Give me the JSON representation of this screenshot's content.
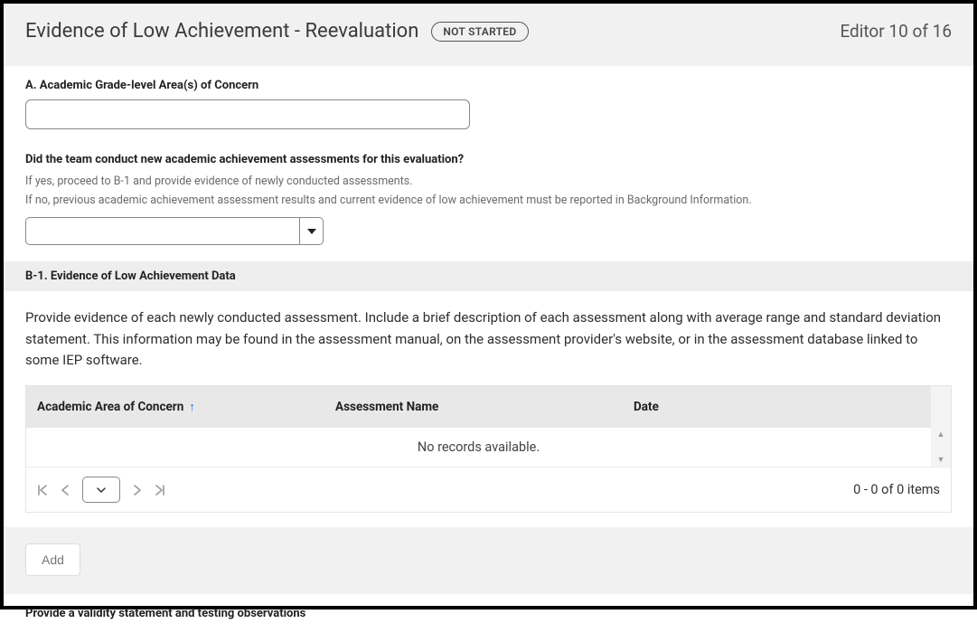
{
  "header": {
    "title": "Evidence of Low Achievement - Reevaluation",
    "status": "NOT STARTED",
    "counter": "Editor 10 of 16"
  },
  "sectionA": {
    "label": "A. Academic Grade-level Area(s) of Concern",
    "value": ""
  },
  "question": {
    "label": "Did the team conduct new academic achievement assessments for this evaluation?",
    "help1": "If yes, proceed to B-1 and provide evidence of newly conducted assessments.",
    "help2": "If no, previous academic achievement assessment results and current evidence of low achievement must be reported in Background Information.",
    "selected": ""
  },
  "sectionB": {
    "heading": "B-1. Evidence of Low Achievement Data",
    "info": "Provide evidence of each newly conducted assessment. Include a brief description of each assessment along with average range and standard deviation statement. This information may be found in the assessment manual, on the assessment provider's website, or in the assessment database linked to some IEP software."
  },
  "table": {
    "columns": {
      "area": "Academic Area of Concern",
      "assessment": "Assessment Name",
      "date": "Date"
    },
    "empty": "No records available.",
    "pager": "0 - 0 of 0 items"
  },
  "add": {
    "label": "Add"
  },
  "validity": {
    "label": "Provide a validity statement and testing observations"
  }
}
